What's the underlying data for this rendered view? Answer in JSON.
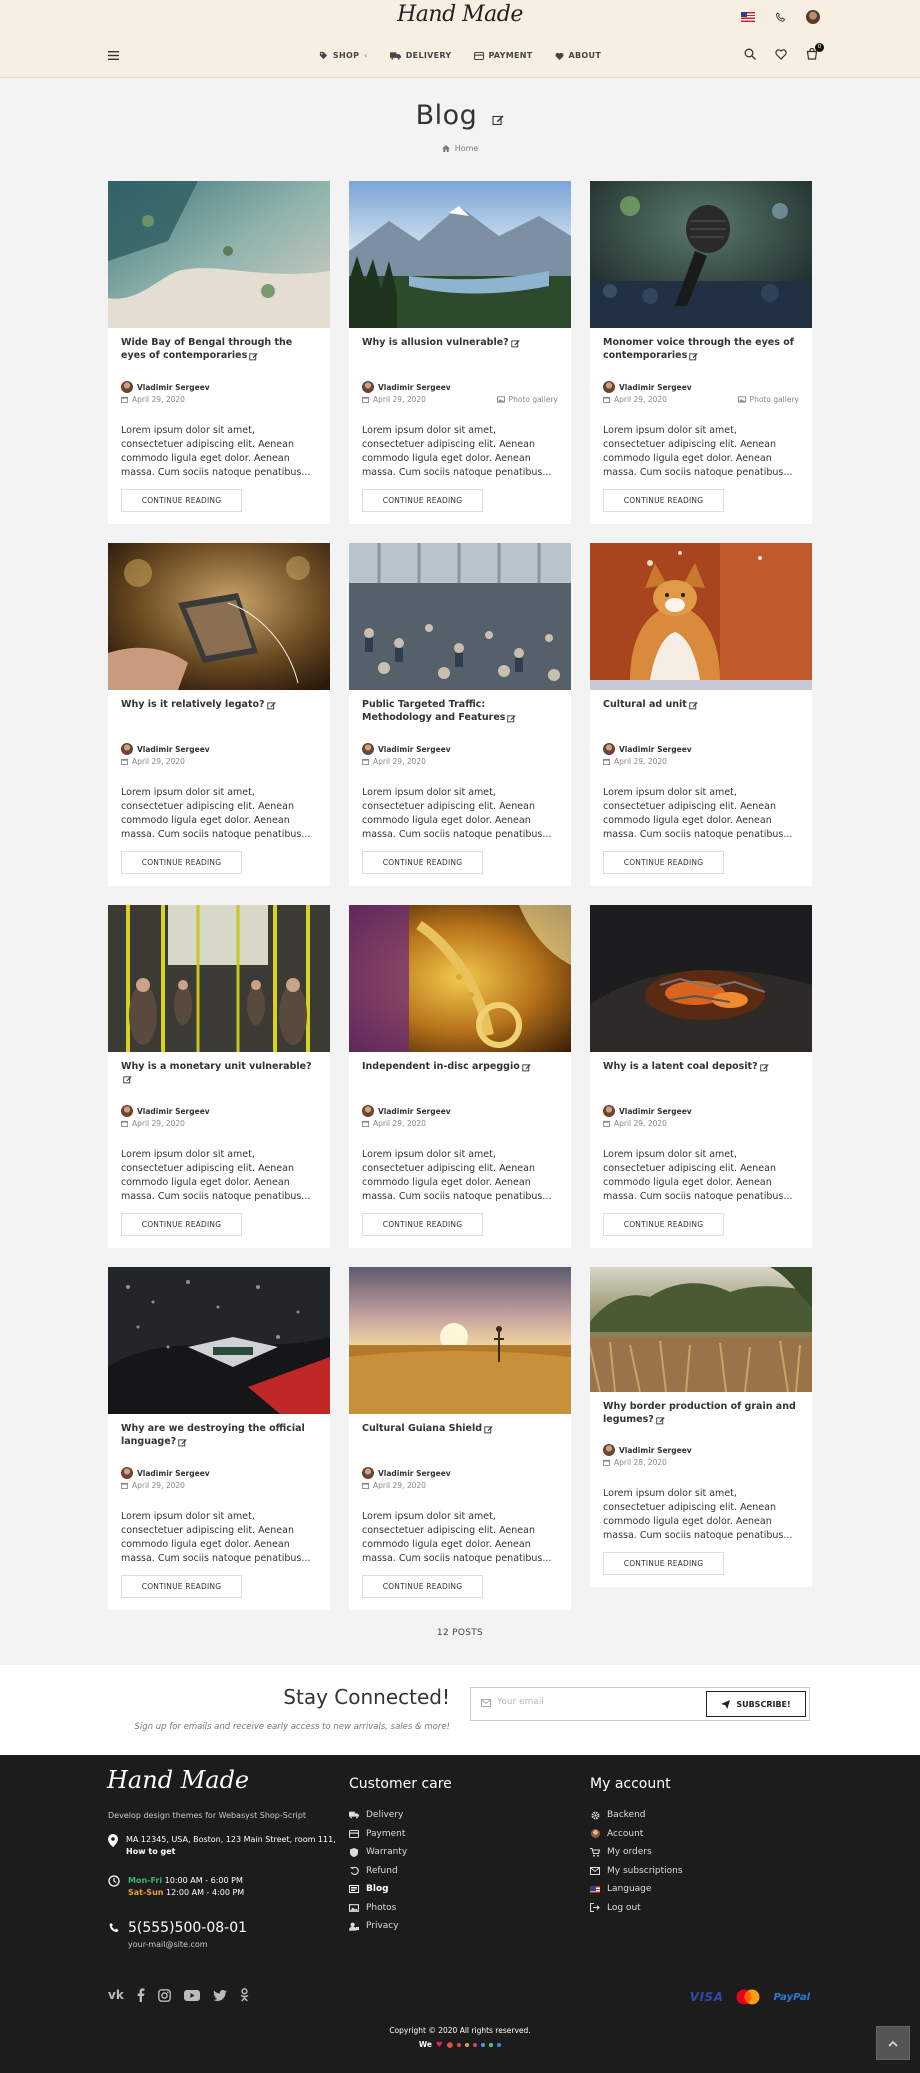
{
  "header": {
    "logo": "Hand Made",
    "nav": [
      {
        "label": "SHOP",
        "icon": "tag-icon",
        "has_sub": true
      },
      {
        "label": "DELIVERY",
        "icon": "truck-icon"
      },
      {
        "label": "PAYMENT",
        "icon": "credit-card-icon"
      },
      {
        "label": "ABOUT",
        "icon": "heart-icon"
      }
    ],
    "cart_count": "0"
  },
  "page": {
    "title": "Blog",
    "breadcrumb": "Home"
  },
  "posts": [
    {
      "title": "Wide Bay of Bengal through the eyes of contemporaries",
      "author": "Vladimir Sergeev",
      "date": "April 29, 2020",
      "gallery": "",
      "excerpt": "Lorem ipsum dolor sit amet, consectetuer adipiscing elit. Aenean commodo ligula eget dolor. Aenean massa. Cum sociis natoque penatibus...",
      "button": "CONTINUE READING"
    },
    {
      "title": "Why is allusion vulnerable?",
      "author": "Vladimir Sergeev",
      "date": "April 29, 2020",
      "gallery": "Photo gallery",
      "excerpt": "Lorem ipsum dolor sit amet, consectetuer adipiscing elit. Aenean commodo ligula eget dolor. Aenean massa. Cum sociis natoque penatibus...",
      "button": "CONTINUE READING"
    },
    {
      "title": "Monomer voice through the eyes of contemporaries",
      "author": "Vladimir Sergeev",
      "date": "April 29, 2020",
      "gallery": "Photo gallery",
      "excerpt": "Lorem ipsum dolor sit amet, consectetuer adipiscing elit. Aenean commodo ligula eget dolor. Aenean massa. Cum sociis natoque penatibus...",
      "button": "CONTINUE READING"
    },
    {
      "title": "Why is it relatively legato?",
      "author": "Vladimir Sergeev",
      "date": "April 29, 2020",
      "gallery": "",
      "excerpt": "Lorem ipsum dolor sit amet, consectetuer adipiscing elit. Aenean commodo ligula eget dolor. Aenean massa. Cum sociis natoque penatibus...",
      "button": "CONTINUE READING"
    },
    {
      "title": "Public Targeted Traffic: Methodology and Features",
      "author": "Vladimir Sergeev",
      "date": "April 29, 2020",
      "gallery": "",
      "excerpt": "Lorem ipsum dolor sit amet, consectetuer adipiscing elit. Aenean commodo ligula eget dolor. Aenean massa. Cum sociis natoque penatibus...",
      "button": "CONTINUE READING"
    },
    {
      "title": "Cultural ad unit",
      "author": "Vladimir Sergeev",
      "date": "April 29, 2020",
      "gallery": "",
      "excerpt": "Lorem ipsum dolor sit amet, consectetuer adipiscing elit. Aenean commodo ligula eget dolor. Aenean massa. Cum sociis natoque penatibus...",
      "button": "CONTINUE READING"
    },
    {
      "title": "Why is a monetary unit vulnerable?",
      "author": "Vladimir Sergeev",
      "date": "April 29, 2020",
      "gallery": "",
      "excerpt": "Lorem ipsum dolor sit amet, consectetuer adipiscing elit. Aenean commodo ligula eget dolor. Aenean massa. Cum sociis natoque penatibus...",
      "button": "CONTINUE READING"
    },
    {
      "title": "Independent in-disc arpeggio",
      "author": "Vladimir Sergeev",
      "date": "April 29, 2020",
      "gallery": "",
      "excerpt": "Lorem ipsum dolor sit amet, consectetuer adipiscing elit. Aenean commodo ligula eget dolor. Aenean massa. Cum sociis natoque penatibus...",
      "button": "CONTINUE READING"
    },
    {
      "title": "Why is a latent coal deposit?",
      "author": "Vladimir Sergeev",
      "date": "April 29, 2020",
      "gallery": "",
      "excerpt": "Lorem ipsum dolor sit amet, consectetuer adipiscing elit. Aenean commodo ligula eget dolor. Aenean massa. Cum sociis natoque penatibus...",
      "button": "CONTINUE READING"
    },
    {
      "title": "Why are we destroying the official language?",
      "author": "Vladimir Sergeev",
      "date": "April 29, 2020",
      "gallery": "",
      "excerpt": "Lorem ipsum dolor sit amet, consectetuer adipiscing elit. Aenean commodo ligula eget dolor. Aenean massa. Cum sociis natoque penatibus...",
      "button": "CONTINUE READING"
    },
    {
      "title": "Cultural Guiana Shield",
      "author": "Vladimir Sergeev",
      "date": "April 29, 2020",
      "gallery": "",
      "excerpt": "Lorem ipsum dolor sit amet, consectetuer adipiscing elit. Aenean commodo ligula eget dolor. Aenean massa. Cum sociis natoque penatibus...",
      "button": "CONTINUE READING"
    },
    {
      "title": "Why border production of grain and legumes?",
      "author": "Vladimir Sergeev",
      "date": "April 28, 2020",
      "gallery": "",
      "excerpt": "Lorem ipsum dolor sit amet, consectetuer adipiscing elit. Aenean commodo ligula eget dolor. Aenean massa. Cum sociis natoque penatibus...",
      "button": "CONTINUE READING"
    }
  ],
  "posts_count": "12 POSTS",
  "newsletter": {
    "title": "Stay Connected!",
    "subtitle": "Sign up for emails and receive early access to new arrivals, sales & more!",
    "placeholder": "Your email",
    "button": "SUBSCRIBE!"
  },
  "footer": {
    "logo": "Hand Made",
    "tagline": "Develop design themes for Webasyst Shop-Script",
    "address": "MA 12345, USA, Boston, 123 Main Street, room 111,",
    "how_to_get": "How to get",
    "hours": [
      {
        "days": "Mon-Fri",
        "time": "10:00 AM - 6:00 PM",
        "color": "#3cb371"
      },
      {
        "days": "Sat-Sun",
        "time": "12:00 AM - 4:00 PM",
        "color": "#e8a33d"
      }
    ],
    "phone": "5(555)500-08-01",
    "email": "your-mail@site.com",
    "customer_care": {
      "title": "Customer care",
      "links": [
        {
          "label": "Delivery",
          "icon": "truck-icon"
        },
        {
          "label": "Payment",
          "icon": "credit-card-icon"
        },
        {
          "label": "Warranty",
          "icon": "shield-icon"
        },
        {
          "label": "Refund",
          "icon": "refund-icon"
        },
        {
          "label": "Blog",
          "icon": "newspaper-icon",
          "active": true
        },
        {
          "label": "Photos",
          "icon": "image-icon"
        },
        {
          "label": "Privacy",
          "icon": "user-lock-icon"
        }
      ]
    },
    "my_account": {
      "title": "My account",
      "links": [
        {
          "label": "Backend",
          "icon": "gear-icon"
        },
        {
          "label": "Account",
          "icon": "avatar-icon"
        },
        {
          "label": "My orders",
          "icon": "cart-icon"
        },
        {
          "label": "My subscriptions",
          "icon": "envelope-icon"
        },
        {
          "label": "Language",
          "icon": "flag-icon"
        },
        {
          "label": "Log out",
          "icon": "logout-icon"
        }
      ]
    },
    "socials": [
      "vk-icon",
      "facebook-icon",
      "instagram-icon",
      "youtube-icon",
      "twitter-icon",
      "odnoklassniki-icon"
    ],
    "payments": {
      "visa": "VISA",
      "paypal": "PayPal"
    },
    "copyright": "Copyright © 2020 All rights reserved.",
    "we": "We"
  }
}
